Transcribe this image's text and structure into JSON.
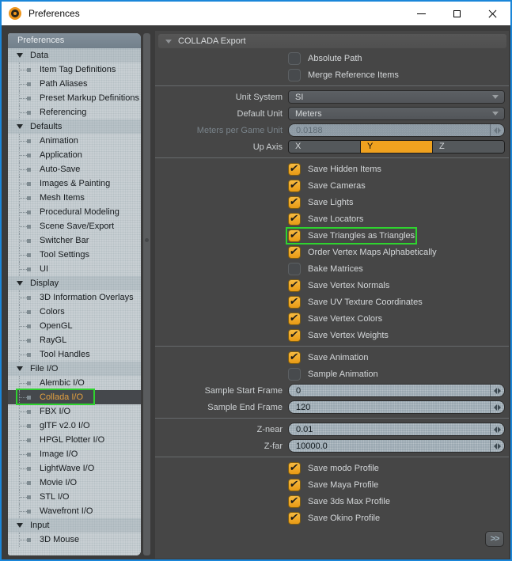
{
  "window": {
    "title": "Preferences"
  },
  "titlebar": {
    "buttons": [
      {
        "name": "minimize"
      },
      {
        "name": "maximize"
      },
      {
        "name": "close"
      }
    ]
  },
  "colors": {
    "accent_orange": "#f0a21f",
    "highlight_green": "#2fd32f",
    "selected_item_text": "#e2a03f",
    "window_border_blue": "#1a86d9"
  },
  "sidebar": {
    "header": "Preferences",
    "tree": [
      {
        "type": "category",
        "label": "Data"
      },
      {
        "type": "item",
        "label": "Item Tag Definitions"
      },
      {
        "type": "item",
        "label": "Path Aliases"
      },
      {
        "type": "item",
        "label": "Preset Markup Definitions"
      },
      {
        "type": "item",
        "label": "Referencing"
      },
      {
        "type": "category",
        "label": "Defaults"
      },
      {
        "type": "item",
        "label": "Animation"
      },
      {
        "type": "item",
        "label": "Application"
      },
      {
        "type": "item",
        "label": "Auto-Save"
      },
      {
        "type": "item",
        "label": "Images & Painting"
      },
      {
        "type": "item",
        "label": "Mesh Items"
      },
      {
        "type": "item",
        "label": "Procedural Modeling"
      },
      {
        "type": "item",
        "label": "Scene Save/Export"
      },
      {
        "type": "item",
        "label": "Switcher Bar"
      },
      {
        "type": "item",
        "label": "Tool Settings"
      },
      {
        "type": "item",
        "label": "UI"
      },
      {
        "type": "category",
        "label": "Display"
      },
      {
        "type": "item",
        "label": "3D Information Overlays"
      },
      {
        "type": "item",
        "label": "Colors"
      },
      {
        "type": "item",
        "label": "OpenGL"
      },
      {
        "type": "item",
        "label": "RayGL"
      },
      {
        "type": "item",
        "label": "Tool Handles"
      },
      {
        "type": "category",
        "label": "File I/O"
      },
      {
        "type": "item",
        "label": "Alembic I/O"
      },
      {
        "type": "item",
        "label": "Collada I/O",
        "selected": true,
        "highlighted": true
      },
      {
        "type": "item",
        "label": "FBX I/O"
      },
      {
        "type": "item",
        "label": "glTF v2.0 I/O"
      },
      {
        "type": "item",
        "label": "HPGL Plotter I/O"
      },
      {
        "type": "item",
        "label": "Image I/O"
      },
      {
        "type": "item",
        "label": "LightWave I/O"
      },
      {
        "type": "item",
        "label": "Movie I/O"
      },
      {
        "type": "item",
        "label": "STL I/O"
      },
      {
        "type": "item",
        "label": "Wavefront I/O"
      },
      {
        "type": "category",
        "label": "Input"
      },
      {
        "type": "item",
        "label": "3D Mouse"
      }
    ]
  },
  "panel": {
    "header": "COLLADA Export",
    "more_button": ">>",
    "rows": [
      {
        "type": "checkbox",
        "label": "Absolute Path",
        "checked": false
      },
      {
        "type": "checkbox",
        "label": "Merge Reference Items",
        "checked": false
      },
      {
        "type": "divider"
      },
      {
        "type": "select",
        "label": "Unit System",
        "value": "SI"
      },
      {
        "type": "select",
        "label": "Default Unit",
        "value": "Meters"
      },
      {
        "type": "field",
        "label": "Meters per Game Unit",
        "value": "0.0188",
        "disabled": true
      },
      {
        "type": "segmented",
        "label": "Up Axis",
        "options": [
          "X",
          "Y",
          "Z"
        ],
        "selected": "Y"
      },
      {
        "type": "divider"
      },
      {
        "type": "checkbox",
        "label": "Save Hidden Items",
        "checked": true
      },
      {
        "type": "checkbox",
        "label": "Save Cameras",
        "checked": true
      },
      {
        "type": "checkbox",
        "label": "Save Lights",
        "checked": true
      },
      {
        "type": "checkbox",
        "label": "Save Locators",
        "checked": true
      },
      {
        "type": "checkbox",
        "label": "Save Triangles as Triangles",
        "checked": true,
        "highlighted": true
      },
      {
        "type": "checkbox",
        "label": "Order Vertex Maps Alphabetically",
        "checked": true
      },
      {
        "type": "checkbox",
        "label": "Bake Matrices",
        "checked": false
      },
      {
        "type": "checkbox",
        "label": "Save Vertex Normals",
        "checked": true
      },
      {
        "type": "checkbox",
        "label": "Save UV Texture Coordinates",
        "checked": true
      },
      {
        "type": "checkbox",
        "label": "Save Vertex Colors",
        "checked": true
      },
      {
        "type": "checkbox",
        "label": "Save Vertex Weights",
        "checked": true
      },
      {
        "type": "divider"
      },
      {
        "type": "checkbox",
        "label": "Save Animation",
        "checked": true
      },
      {
        "type": "checkbox",
        "label": "Sample Animation",
        "checked": false
      },
      {
        "type": "field",
        "label": "Sample Start Frame",
        "value": "0"
      },
      {
        "type": "field",
        "label": "Sample End Frame",
        "value": "120"
      },
      {
        "type": "divider"
      },
      {
        "type": "field",
        "label": "Z-near",
        "value": "0.01"
      },
      {
        "type": "field",
        "label": "Z-far",
        "value": "10000.0"
      },
      {
        "type": "divider"
      },
      {
        "type": "checkbox",
        "label": "Save modo Profile",
        "checked": true
      },
      {
        "type": "checkbox",
        "label": "Save Maya Profile",
        "checked": true
      },
      {
        "type": "checkbox",
        "label": "Save 3ds Max Profile",
        "checked": true
      },
      {
        "type": "checkbox",
        "label": "Save Okino Profile",
        "checked": true
      }
    ]
  }
}
